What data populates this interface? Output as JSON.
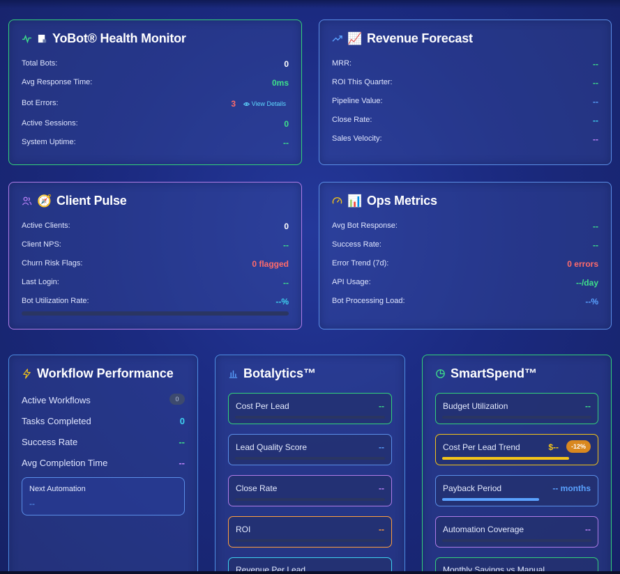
{
  "health": {
    "title": "YoBot® Health Monitor",
    "rows": [
      {
        "label": "Total Bots:",
        "value": "0"
      },
      {
        "label": "Avg Response Time:",
        "value": "0ms"
      },
      {
        "label": "Bot Errors:",
        "value": "3"
      },
      {
        "label": "Active Sessions:",
        "value": "0"
      },
      {
        "label": "System Uptime:",
        "value": "--"
      }
    ],
    "view_details": "View Details"
  },
  "revenue": {
    "title": "Revenue Forecast",
    "rows": [
      {
        "label": "MRR:",
        "value": "--"
      },
      {
        "label": "ROI This Quarter:",
        "value": "--"
      },
      {
        "label": "Pipeline Value:",
        "value": "--"
      },
      {
        "label": "Close Rate:",
        "value": "--"
      },
      {
        "label": "Sales Velocity:",
        "value": "--"
      }
    ]
  },
  "client": {
    "title": "Client Pulse",
    "rows": [
      {
        "label": "Active Clients:",
        "value": "0"
      },
      {
        "label": "Client NPS:",
        "value": "--"
      },
      {
        "label": "Churn Risk Flags:",
        "value": "0 flagged"
      },
      {
        "label": "Last Login:",
        "value": "--"
      },
      {
        "label": "Bot Utilization Rate:",
        "value": "--%"
      }
    ]
  },
  "ops": {
    "title": "Ops Metrics",
    "rows": [
      {
        "label": "Avg Bot Response:",
        "value": "--"
      },
      {
        "label": "Success Rate:",
        "value": "--"
      },
      {
        "label": "Error Trend (7d):",
        "value": "0 errors"
      },
      {
        "label": "API Usage:",
        "value": "--/day"
      },
      {
        "label": "Bot Processing Load:",
        "value": "--%"
      }
    ]
  },
  "workflow": {
    "title": "Workflow Performance",
    "rows": [
      {
        "label": "Active Workflows",
        "value": "0"
      },
      {
        "label": "Tasks Completed",
        "value": "0"
      },
      {
        "label": "Success Rate",
        "value": "--"
      },
      {
        "label": "Avg Completion Time",
        "value": "--"
      }
    ],
    "next_title": "Next Automation",
    "next_value": "--"
  },
  "botalytics": {
    "title": "Botalytics™",
    "metrics": [
      {
        "label": "Cost Per Lead",
        "value": "--"
      },
      {
        "label": "Lead Quality Score",
        "value": "--"
      },
      {
        "label": "Close Rate",
        "value": "--"
      },
      {
        "label": "ROI",
        "value": "--"
      },
      {
        "label": "Revenue Per Lead",
        "value": ""
      }
    ]
  },
  "smartspend": {
    "title": "SmartSpend™",
    "metrics": [
      {
        "label": "Budget Utilization",
        "value": "--",
        "fill": 0
      },
      {
        "label": "Cost Per Lead Trend",
        "value": "$--",
        "badge": "-12%",
        "fill": 0.85
      },
      {
        "label": "Payback Period",
        "value": "-- months",
        "fill": 0.65
      },
      {
        "label": "Automation Coverage",
        "value": "--",
        "fill": 0
      },
      {
        "label": "Monthly Savings vs Manual",
        "value": "",
        "fill": 0
      }
    ]
  },
  "colors": {
    "green": "#3ee08a",
    "red": "#ff6b6b",
    "blue": "#5aa2ff",
    "cyan": "#3fd2f0",
    "purple": "#c084fc",
    "orange": "#ff9f40",
    "yellow": "#f5c518"
  }
}
